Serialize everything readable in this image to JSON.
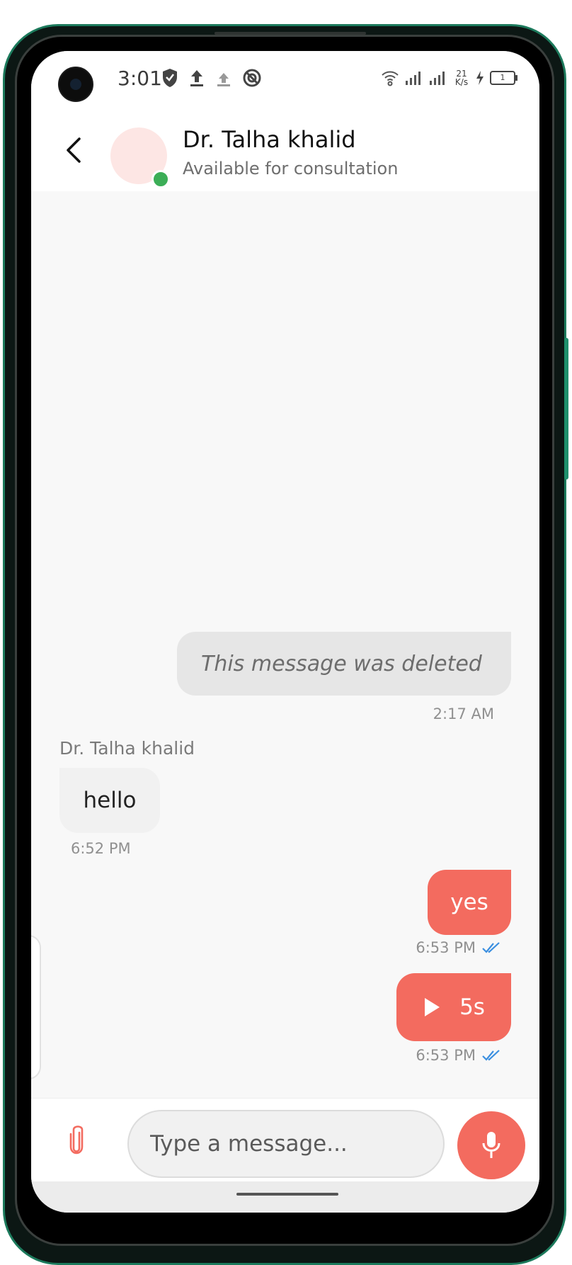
{
  "status_bar": {
    "time": "3:01",
    "network_speed_value": "21",
    "network_speed_unit": "K/s",
    "battery_level": "1"
  },
  "header": {
    "contact_name": "Dr. Talha khalid",
    "contact_status": "Available for consultation",
    "online_color": "#3cae57"
  },
  "messages": [
    {
      "direction": "outgoing",
      "type": "deleted",
      "text": "This message was deleted",
      "time": "2:17 AM"
    },
    {
      "direction": "incoming",
      "type": "text",
      "sender": "Dr. Talha khalid",
      "text": "hello",
      "time": "6:52 PM"
    },
    {
      "direction": "outgoing",
      "type": "text",
      "text": "yes",
      "time": "6:53 PM",
      "read": true
    },
    {
      "direction": "outgoing",
      "type": "voice",
      "duration": "5s",
      "time": "6:53 PM",
      "read": true
    }
  ],
  "composer": {
    "placeholder": "Type a message...",
    "attach_icon": "paperclip-icon",
    "mic_icon": "microphone-icon"
  },
  "colors": {
    "accent": "#f36b5f",
    "read_check": "#3b8fe0",
    "frame_green": "#1c7a5c"
  }
}
